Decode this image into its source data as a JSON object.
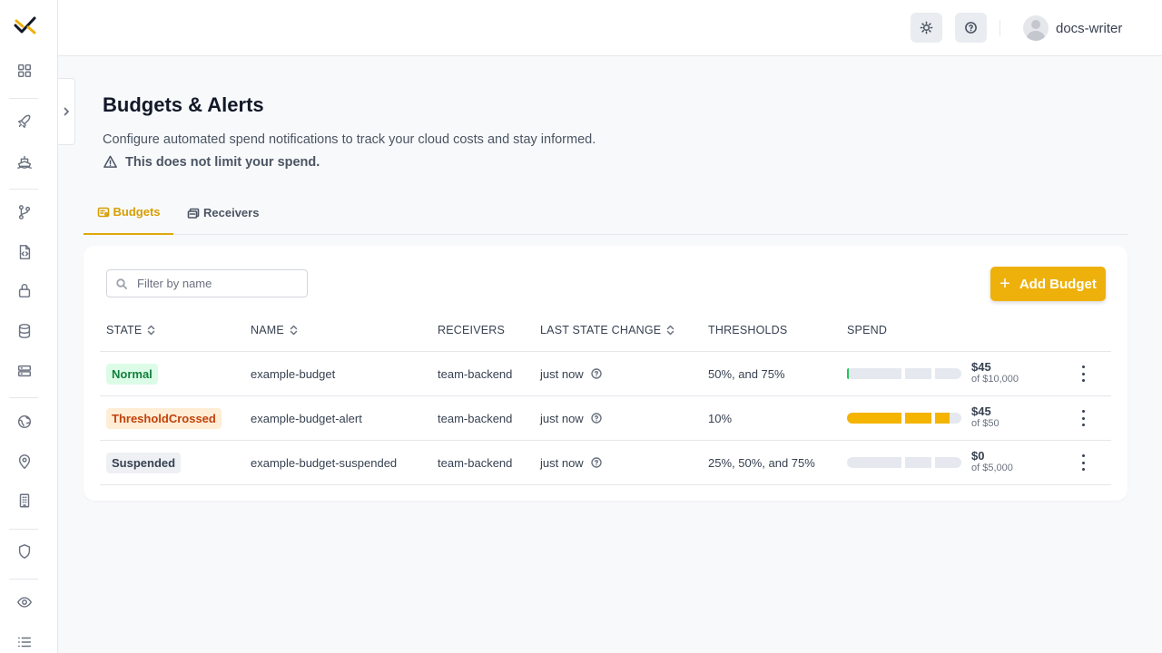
{
  "app": {
    "logo": "logo-icon",
    "colors": {
      "accent": "#eeb10b",
      "accent_text": "#d69e00"
    }
  },
  "sidebar": {
    "icons": [
      "dashboard-icon",
      "rocket-icon",
      "ship-icon",
      "git-branch-icon",
      "file-code-icon",
      "lock-icon",
      "database-icon",
      "server-icon",
      "globe-icon",
      "location-pin-icon",
      "building-icon",
      "shield-icon",
      "eye-icon",
      "list-icon"
    ]
  },
  "topbar": {
    "theme_icon": "sun-icon",
    "help_icon": "help-circle-icon",
    "username": "docs-writer"
  },
  "header": {
    "title": "Budgets & Alerts",
    "description": "Configure automated spend notifications to track your cloud costs and stay informed.",
    "warning": "This does not limit your spend."
  },
  "tabs": [
    {
      "label": "Budgets",
      "active": true
    },
    {
      "label": "Receivers",
      "active": false
    }
  ],
  "filter": {
    "placeholder": "Filter by name",
    "value": ""
  },
  "add_button": {
    "label": "Add Budget"
  },
  "table": {
    "columns": [
      "STATE",
      "NAME",
      "RECEIVERS",
      "LAST STATE CHANGE",
      "THRESHOLDS",
      "SPEND"
    ],
    "rows": [
      {
        "state": "Normal",
        "state_kind": "normal",
        "name": "example-budget",
        "receivers": "team-backend",
        "last_change": "just now",
        "thresholds": "50%, and 75%",
        "spend": "$45",
        "limit": "of $10,000",
        "spend_fraction": 0.0045,
        "bar_color": "#22c55e"
      },
      {
        "state": "ThresholdCrossed",
        "state_kind": "crossed",
        "name": "example-budget-alert",
        "receivers": "team-backend",
        "last_change": "just now",
        "thresholds": "10%",
        "spend": "$45",
        "limit": "of $50",
        "spend_fraction": 0.9,
        "bar_color": "#f5b400"
      },
      {
        "state": "Suspended",
        "state_kind": "suspended",
        "name": "example-budget-suspended",
        "receivers": "team-backend",
        "last_change": "just now",
        "thresholds": "25%, 50%, and 75%",
        "spend": "$0",
        "limit": "of $5,000",
        "spend_fraction": 0,
        "bar_color": "#e5e9ef"
      }
    ]
  }
}
